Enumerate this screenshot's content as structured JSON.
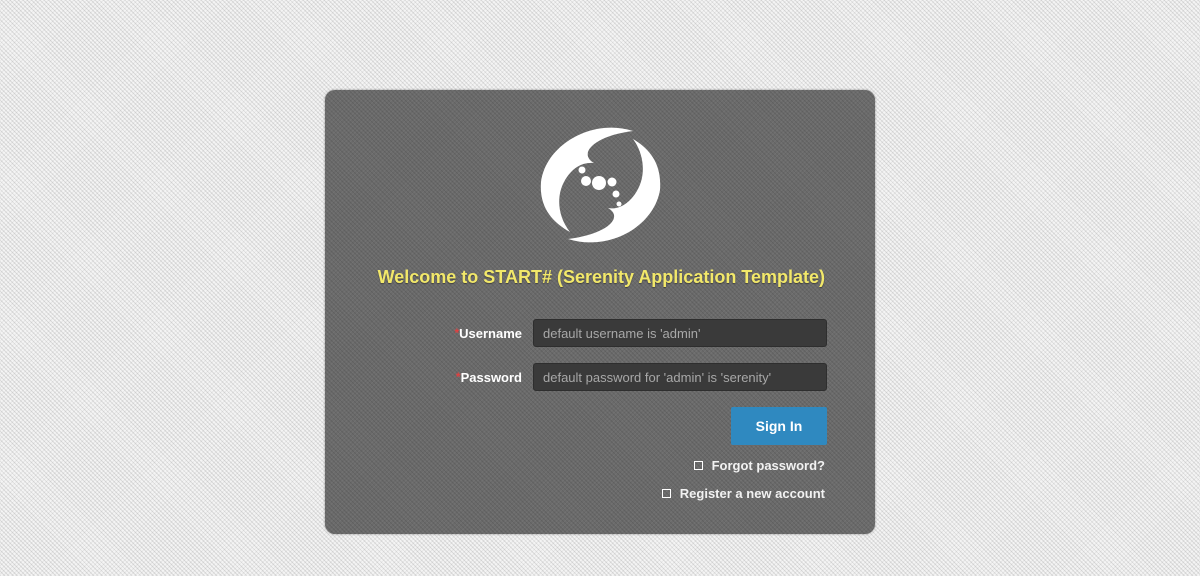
{
  "login": {
    "welcome_text": "Welcome to START# (Serenity Application Template)",
    "required_marker": "*",
    "username": {
      "label": "Username",
      "value": "",
      "placeholder": "default username is 'admin'"
    },
    "password": {
      "label": "Password",
      "value": "",
      "placeholder": "default password for 'admin' is 'serenity'"
    },
    "signin_label": "Sign In",
    "forgot_label": "Forgot password?",
    "register_label": "Register a new account"
  },
  "icons": {
    "logo": "serenity-swirl-logo",
    "forgot": "checkbox-square-icon",
    "register": "checkbox-square-icon"
  },
  "colors": {
    "panel": "#6b6b6b",
    "welcome_text": "#f2e86a",
    "button": "#2f89c0",
    "required": "#e04040"
  }
}
